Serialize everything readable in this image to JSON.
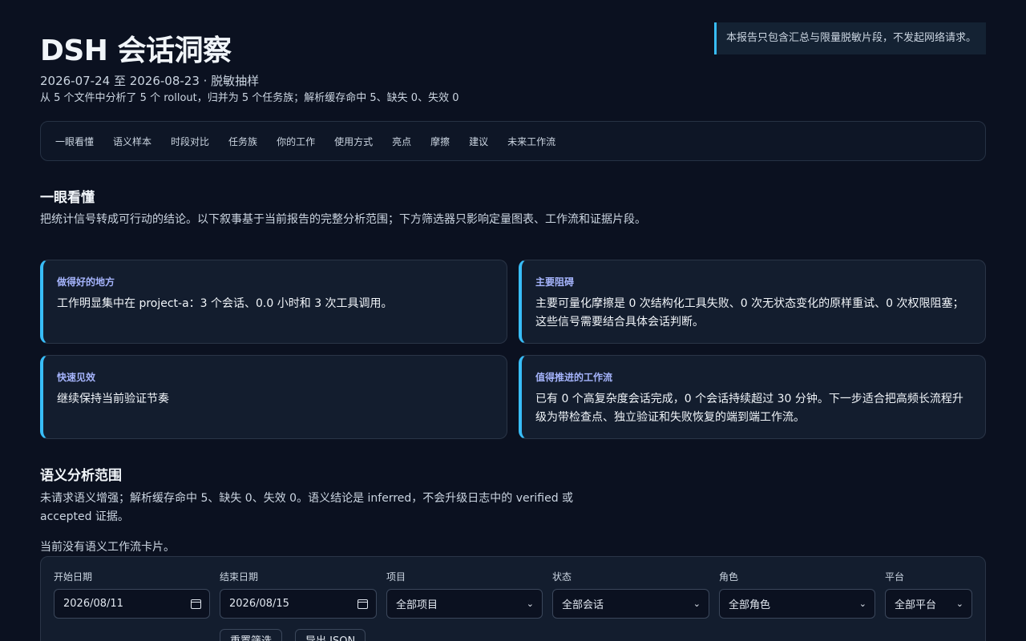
{
  "header": {
    "title": "DSH 会话洞察",
    "subtitle": "2026-07-24 至 2026-08-23 · 脱敏抽样",
    "meta": "从 5 个文件中分析了 5 个 rollout，归并为 5 个任务族；解析缓存命中 5、缺失 0、失效 0",
    "notice": "本报告只包含汇总与限量脱敏片段，不发起网络请求。"
  },
  "nav": {
    "items": [
      "一眼看懂",
      "语义样本",
      "时段对比",
      "任务族",
      "你的工作",
      "使用方式",
      "亮点",
      "摩擦",
      "建议",
      "未来工作流"
    ]
  },
  "overview": {
    "title": "一眼看懂",
    "desc": "把统计信号转成可行动的结论。以下叙事基于当前报告的完整分析范围；下方筛选器只影响定量图表、工作流和证据片段。",
    "cards": [
      {
        "label": "做得好的地方",
        "text": "工作明显集中在 project-a：3 个会话、0.0 小时和 3 次工具调用。"
      },
      {
        "label": "主要阻碍",
        "text": "主要可量化摩擦是 0 次结构化工具失败、0 次无状态变化的原样重试、0 次权限阻塞；这些信号需要结合具体会话判断。"
      },
      {
        "label": "快速见效",
        "text": "继续保持当前验证节奏"
      },
      {
        "label": "值得推进的工作流",
        "text": "已有 0 个高复杂度会话完成，0 个会话持续超过 30 分钟。下一步适合把高频长流程升级为带检查点、独立验证和失败恢复的端到端工作流。"
      }
    ]
  },
  "semantic": {
    "title": "语义分析范围",
    "desc": "未请求语义增强；解析缓存命中 5、缺失 0、失效 0。语义结论是 inferred，不会升级日志中的 verified 或 accepted 证据。",
    "empty": "当前没有语义工作流卡片。"
  },
  "filters": {
    "start_label": "开始日期",
    "start_value": "2026/08/11",
    "end_label": "结束日期",
    "end_value": "2026/08/15",
    "project_label": "项目",
    "project_value": "全部项目",
    "status_label": "状态",
    "status_value": "全部会话",
    "role_label": "角色",
    "role_value": "全部角色",
    "platform_label": "平台",
    "platform_value": "全部平台",
    "reset_label": "重置筛选",
    "export_label": "导出 JSON"
  },
  "colors": {
    "background": "#0b1120",
    "accent": "#38bdf8",
    "card_label": "#a5b4fc"
  }
}
